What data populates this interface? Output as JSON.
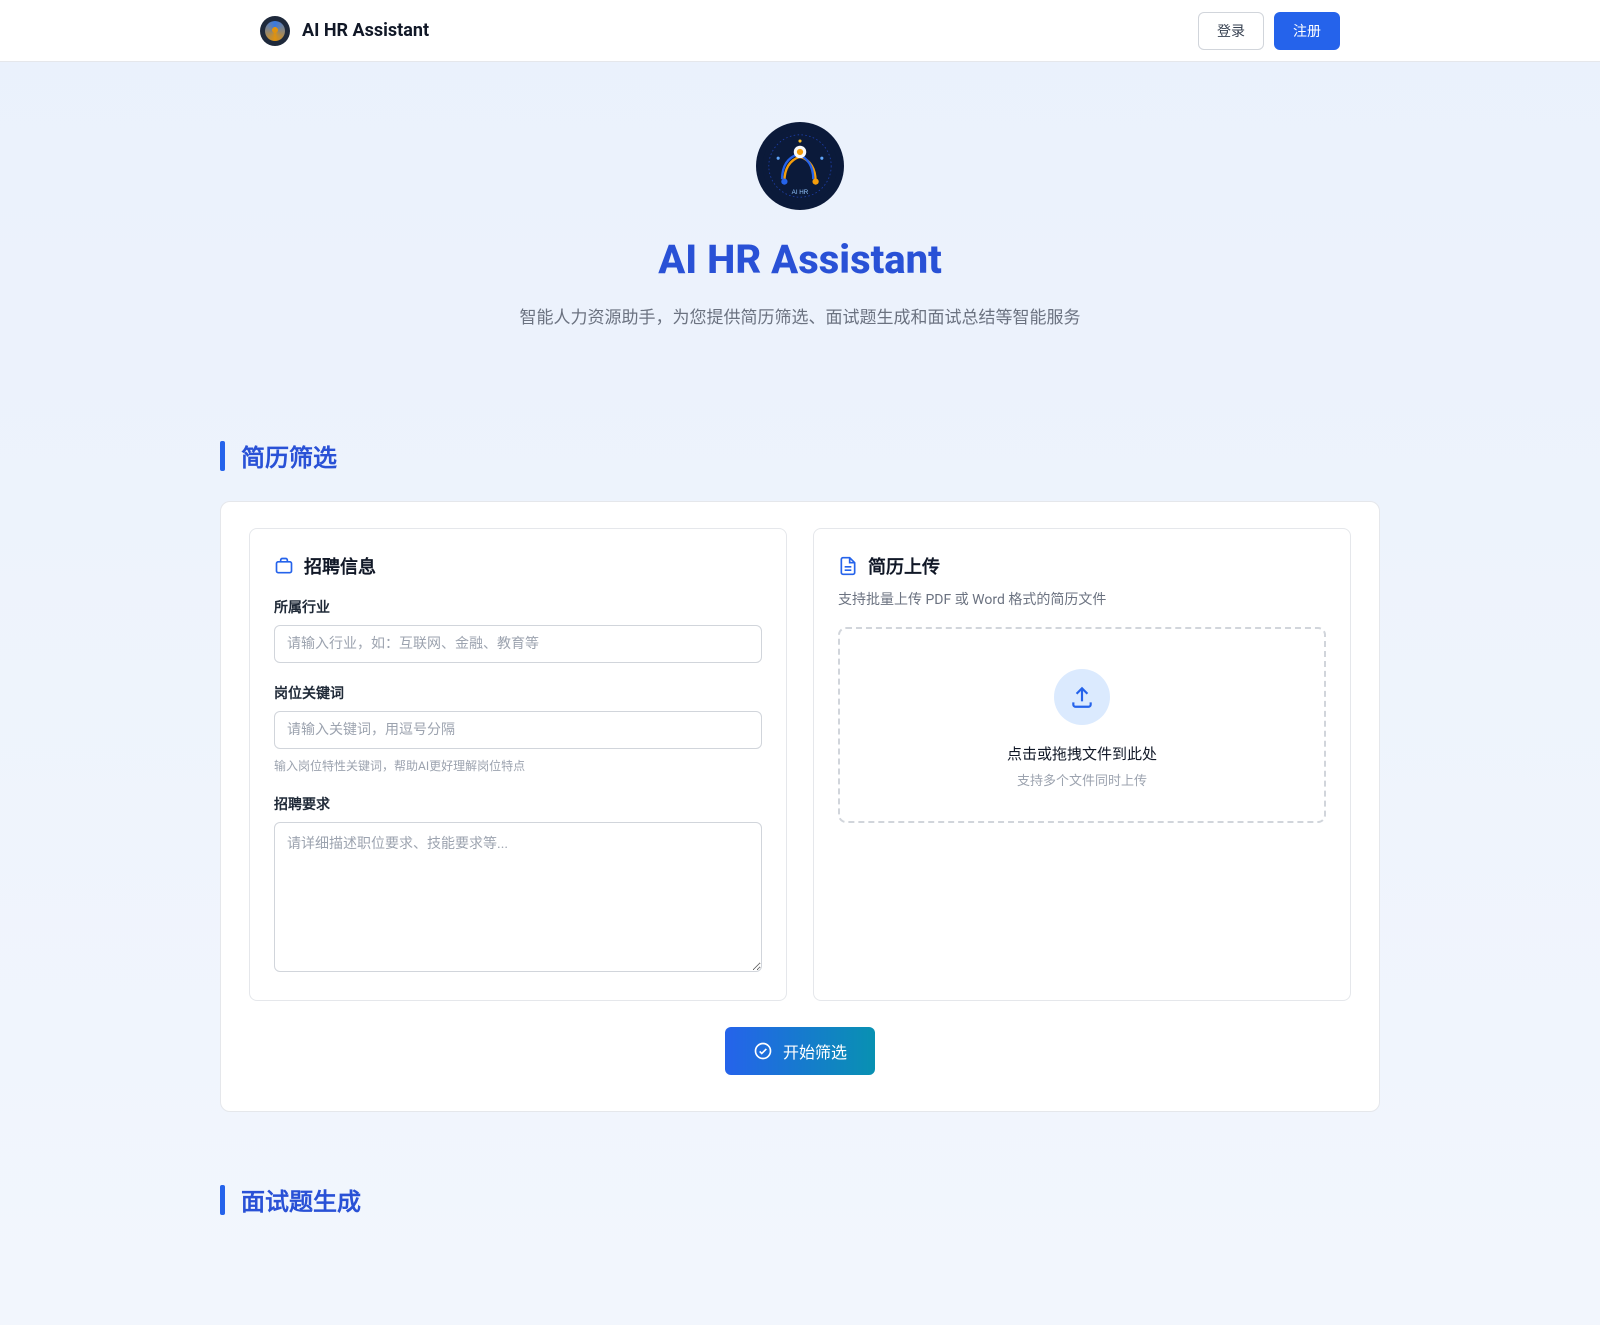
{
  "header": {
    "app_title": "AI HR Assistant",
    "login_label": "登录",
    "register_label": "注册"
  },
  "hero": {
    "title": "AI HR Assistant",
    "subtitle": "智能人力资源助手，为您提供简历筛选、面试题生成和面试总结等智能服务"
  },
  "sections": {
    "resume_screening": "简历筛选",
    "interview_questions": "面试题生成"
  },
  "recruit_panel": {
    "title": "招聘信息",
    "industry_label": "所属行业",
    "industry_placeholder": "请输入行业，如：互联网、金融、教育等",
    "keywords_label": "岗位关键词",
    "keywords_placeholder": "请输入关键词，用逗号分隔",
    "keywords_help": "输入岗位特性关键词，帮助AI更好理解岗位特点",
    "requirements_label": "招聘要求",
    "requirements_placeholder": "请详细描述职位要求、技能要求等..."
  },
  "upload_panel": {
    "title": "简历上传",
    "subtitle": "支持批量上传 PDF 或 Word 格式的简历文件",
    "box_title": "点击或拖拽文件到此处",
    "box_subtitle": "支持多个文件同时上传"
  },
  "actions": {
    "start_screening": "开始筛选"
  }
}
